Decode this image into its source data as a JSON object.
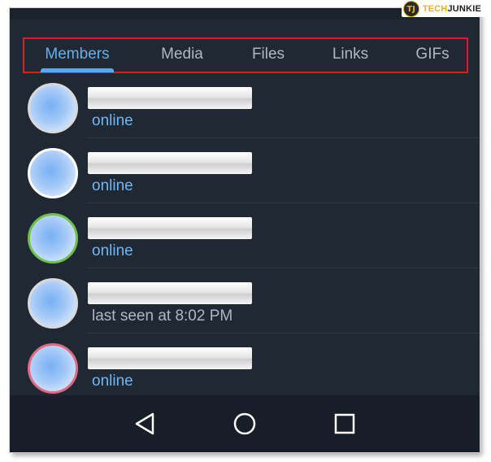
{
  "watermark": {
    "logo_text": "TJ",
    "brand_a": "TECH",
    "brand_b": "JUNKIE"
  },
  "tabs": [
    {
      "label": "Members",
      "active": true
    },
    {
      "label": "Media",
      "active": false
    },
    {
      "label": "Files",
      "active": false
    },
    {
      "label": "Links",
      "active": false
    },
    {
      "label": "GIFs",
      "active": false
    }
  ],
  "members": [
    {
      "status": "online",
      "avatar_border": "#d9d9d9"
    },
    {
      "status": "online",
      "avatar_border": "#ffffff"
    },
    {
      "status": "online",
      "avatar_border": "#6ec04c"
    },
    {
      "status": "last seen at 8:02 PM",
      "avatar_border": "#d9d9d9"
    },
    {
      "status": "online",
      "avatar_border": "#e06a84"
    }
  ],
  "colors": {
    "background": "#1f2833",
    "active_tab": "#62b1f0",
    "inactive_tab": "#aeb7c2",
    "online": "#70b8f2",
    "highlight_box": "#e01b1b"
  },
  "navigation": [
    "back-icon",
    "home-icon",
    "recents-icon"
  ]
}
